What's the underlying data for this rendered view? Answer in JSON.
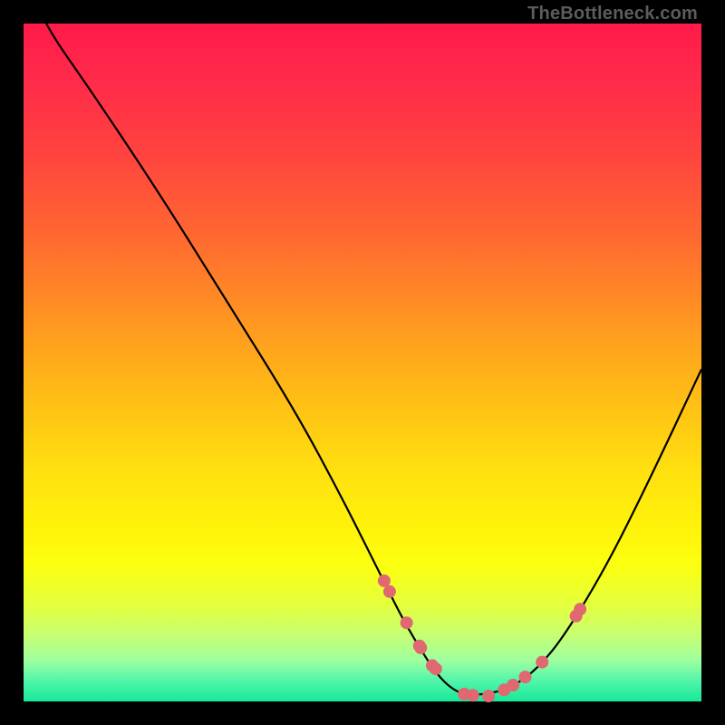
{
  "attribution": "TheBottleneck.com",
  "chart_data": {
    "type": "line",
    "title": "",
    "xlabel": "",
    "ylabel": "",
    "xlim": [
      0,
      100
    ],
    "ylim": [
      0,
      100
    ],
    "series": [
      {
        "name": "bottleneck-curve",
        "x": [
          0,
          3,
          10,
          20,
          30,
          40,
          47,
          53,
          56,
          59,
          61,
          63,
          65,
          68,
          72,
          76,
          80,
          86,
          92,
          100
        ],
        "y": [
          108,
          100,
          90,
          75,
          59,
          43,
          30,
          18,
          12,
          7,
          4,
          2,
          1,
          1,
          2,
          5,
          10,
          20,
          32,
          49
        ]
      }
    ],
    "markers": {
      "name": "data-points",
      "color": "#e06870",
      "x": [
        53.2,
        54.0,
        56.5,
        58.4,
        58.6,
        60.3,
        60.8,
        65.0,
        66.3,
        68.6,
        70.9,
        72.2,
        74.0,
        76.5,
        81.5,
        82.1
      ],
      "y": [
        17.8,
        16.2,
        11.6,
        8.2,
        7.9,
        5.3,
        4.8,
        1.1,
        0.9,
        0.8,
        1.7,
        2.4,
        3.6,
        5.8,
        12.6,
        13.6
      ]
    }
  }
}
